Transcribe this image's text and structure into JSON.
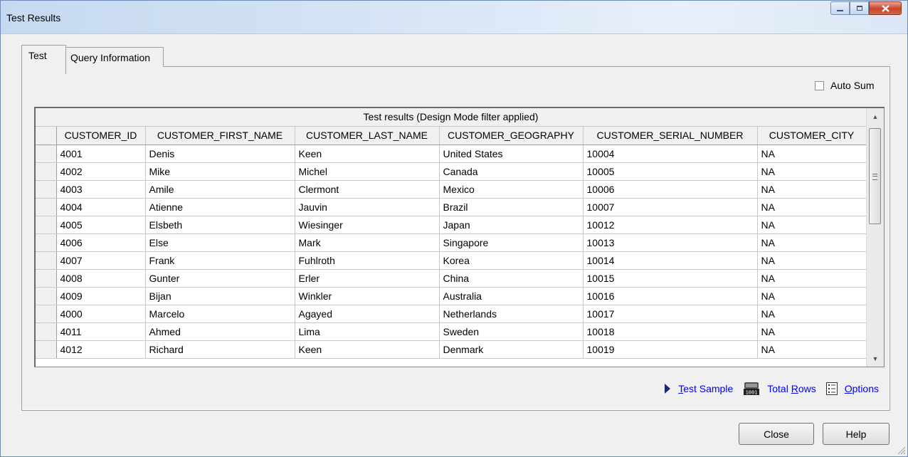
{
  "window": {
    "title": "Test Results"
  },
  "tabs": [
    {
      "label": "Test",
      "active": true
    },
    {
      "label": "Query Information",
      "active": false
    }
  ],
  "auto_sum": {
    "label": "Auto Sum",
    "checked": false
  },
  "grid": {
    "caption": "Test results (Design Mode filter applied)",
    "columns": [
      "CUSTOMER_ID",
      "CUSTOMER_FIRST_NAME",
      "CUSTOMER_LAST_NAME",
      "CUSTOMER_GEOGRAPHY",
      "CUSTOMER_SERIAL_NUMBER",
      "CUSTOMER_CITY"
    ],
    "rows": [
      [
        "4001",
        "Denis",
        "Keen",
        "United States",
        "10004",
        "NA"
      ],
      [
        "4002",
        "Mike",
        "Michel",
        "Canada",
        "10005",
        "NA"
      ],
      [
        "4003",
        "Amile",
        "Clermont",
        "Mexico",
        "10006",
        "NA"
      ],
      [
        "4004",
        "Atienne",
        "Jauvin",
        "Brazil",
        "10007",
        "NA"
      ],
      [
        "4005",
        "Elsbeth",
        "Wiesinger",
        "Japan",
        "10012",
        "NA"
      ],
      [
        "4006",
        "Else",
        "Mark",
        "Singapore",
        "10013",
        "NA"
      ],
      [
        "4007",
        "Frank",
        "Fuhlroth",
        "Korea",
        "10014",
        "NA"
      ],
      [
        "4008",
        "Gunter",
        "Erler",
        "China",
        "10015",
        "NA"
      ],
      [
        "4009",
        "Bijan",
        "Winkler",
        "Australia",
        "10016",
        "NA"
      ],
      [
        "4000",
        "Marcelo",
        "Agayed",
        "Netherlands",
        "10017",
        "NA"
      ],
      [
        "4011",
        "Ahmed",
        "Lima",
        "Sweden",
        "10018",
        "NA"
      ],
      [
        "4012",
        "Richard",
        "Keen",
        "Denmark",
        "10019",
        "NA"
      ]
    ]
  },
  "actions": {
    "test_sample": {
      "label": "Test Sample",
      "icon": "play-triangle-icon"
    },
    "total_rows": {
      "label": "Total Rows",
      "icon": "counter-1001-icon"
    },
    "options": {
      "label": "Options",
      "icon": "options-list-icon"
    }
  },
  "buttons": {
    "close": "Close",
    "help": "Help"
  },
  "colors": {
    "link": "#0000ee",
    "title_bar": "#c6d9f1",
    "close_button": "#c9442b"
  }
}
